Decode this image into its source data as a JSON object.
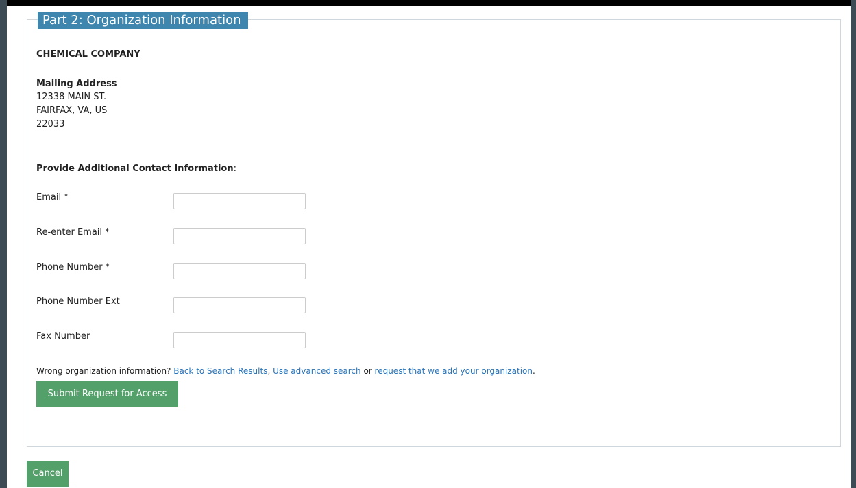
{
  "section": {
    "legend": "Part 2: Organization Information"
  },
  "organization": {
    "name": "CHEMICAL COMPANY",
    "mailing_title": "Mailing Address",
    "address_lines": [
      "12338 MAIN ST.",
      "FAIRFAX, VA, US",
      "22033"
    ]
  },
  "contact": {
    "heading_bold": "Provide Additional Contact Information",
    "heading_suffix": ":",
    "fields": [
      {
        "label": "Email *",
        "value": ""
      },
      {
        "label": "Re-enter Email *",
        "value": ""
      },
      {
        "label": "Phone Number *",
        "value": ""
      },
      {
        "label": "Phone Number Ext",
        "value": ""
      },
      {
        "label": "Fax Number",
        "value": ""
      }
    ]
  },
  "wrong_info": {
    "prefix": "Wrong organization information? ",
    "link_back": "Back to Search Results",
    "sep1": ", ",
    "link_advanced": "Use advanced search",
    "sep2": " or ",
    "link_request": "request that we add your organization",
    "suffix": "."
  },
  "buttons": {
    "submit": "Submit Request for Access",
    "cancel": "Cancel"
  },
  "colors": {
    "legend_bg": "#3e86ad",
    "button_green": "#54a06a",
    "link_blue": "#2a74b8",
    "frame_side": "#3d4b55"
  }
}
